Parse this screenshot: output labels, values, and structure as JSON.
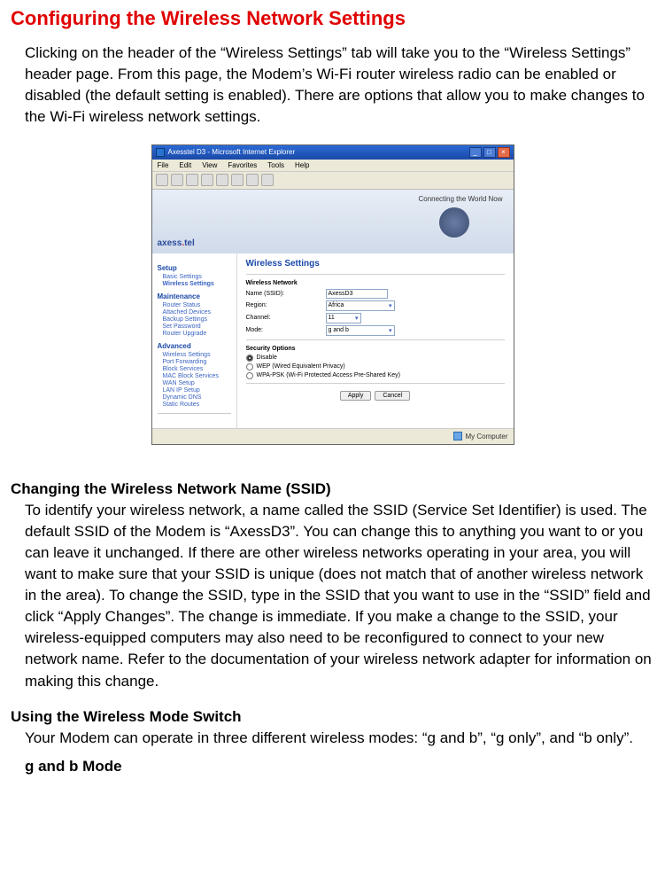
{
  "doc": {
    "title": "Configuring the Wireless Network Settings",
    "intro": "Clicking on the header of the “Wireless Settings” tab will take you to the “Wireless Settings” header page. From this page, the Modem’s Wi-Fi router wireless radio can be enabled or disabled (the default setting is enabled). There are options that allow you to make changes to the Wi-Fi wireless network settings.",
    "ssid_heading": "Changing the Wireless Network Name (SSID)",
    "ssid_body": "To identify your wireless network, a name called the SSID (Service Set Identifier) is used. The default SSID of the Modem is “AxessD3”. You can change this to anything you want to or you can leave it unchanged. If there are other wireless networks operating in your area, you will want to make sure that your SSID is unique (does not match that of another wireless network in the area). To change the SSID, type in the SSID that you want to use in the “SSID” field and click “Apply Changes”. The change is immediate. If you make a change to the SSID, your wireless-equipped computers may also need to be reconfigured to connect to your new network name. Refer to the documentation of your wireless network adapter for information on making this change.",
    "mode_heading": "Using the Wireless Mode Switch",
    "mode_body": "Your Modem can operate in three different wireless modes: “g and b”, “g only”, and “b only”.",
    "gb_heading": "g and b Mode"
  },
  "window": {
    "title": "Axesstel D3 - Microsoft Internet Explorer",
    "menus": {
      "file": "File",
      "edit": "Edit",
      "view": "View",
      "favorites": "Favorites",
      "tools": "Tools",
      "help": "Help"
    },
    "tagline": "Connecting the World Now",
    "logo_a": "axess",
    "logo_b": "tel",
    "status": "My Computer"
  },
  "sidebar": {
    "group1": "Setup",
    "basic": "Basic Settings",
    "wireless": "Wireless Settings",
    "group2": "Maintenance",
    "router_status": "Router Status",
    "attached": "Attached Devices",
    "backup": "Backup Settings",
    "set_password": "Set Password",
    "upgrade": "Router Upgrade",
    "group3": "Advanced",
    "adv_wireless": "Wireless Settings",
    "port_fwd": "Port Forwarding",
    "block_svc": "Block Services",
    "mac_block": "MAC Block Services",
    "wan": "WAN Setup",
    "lan": "LAN IP Setup",
    "ddns": "Dynamic DNS",
    "static": "Static Routes"
  },
  "main": {
    "heading": "Wireless Settings",
    "section1": "Wireless Network",
    "name_label": "Name (SSID):",
    "name_value": "AxessD3",
    "region_label": "Region:",
    "region_value": "Africa",
    "channel_label": "Channel:",
    "channel_value": "11",
    "mode_label": "Mode:",
    "mode_value": "g and b",
    "section2": "Security Options",
    "opt_disable": "Disable",
    "opt_wep": "WEP (Wired Equivalent Privacy)",
    "opt_wpa": "WPA-PSK (Wi-Fi Protected Access Pre-Shared Key)",
    "apply": "Apply",
    "cancel": "Cancel"
  }
}
